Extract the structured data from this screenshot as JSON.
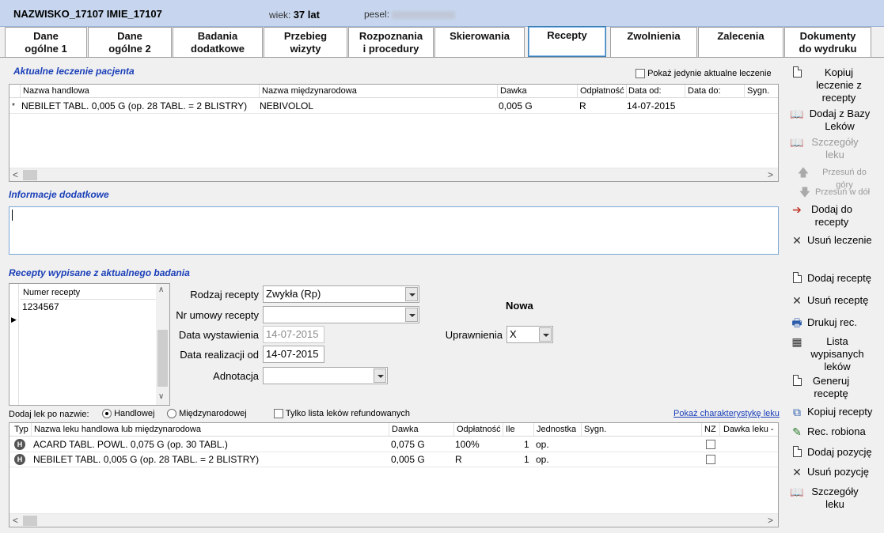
{
  "header": {
    "patient_name": "NAZWISKO_17107 IMIE_17107",
    "age_label": "wiek:",
    "age_value": "37 lat",
    "pesel_label": "pesel:"
  },
  "tabs": [
    {
      "line1": "Dane",
      "line2": "ogólne 1"
    },
    {
      "line1": "Dane",
      "line2": "ogólne 2"
    },
    {
      "line1": "Badania",
      "line2": "dodatkowe"
    },
    {
      "line1": "Przebieg",
      "line2": "wizyty"
    },
    {
      "line1": "Rozpoznania",
      "line2": "i procedury"
    },
    {
      "line1": "Skierowania",
      "line2": ""
    },
    {
      "line1": "Recepty",
      "line2": ""
    },
    {
      "line1": "Zwolnienia",
      "line2": ""
    },
    {
      "line1": "Zalecenia",
      "line2": ""
    },
    {
      "line1": "Dokumenty",
      "line2": "do wydruku"
    }
  ],
  "current_treatment": {
    "title": "Aktualne leczenie pacjenta",
    "only_current_label": "Pokaż jedynie aktualne leczenie",
    "columns": [
      "Nazwa handlowa",
      "Nazwa międzynarodowa",
      "Dawka",
      "Odpłatność",
      "Data od:",
      "Data do:",
      "Sygn."
    ],
    "rows": [
      {
        "marker": "*",
        "trade": "NEBILET TABL. 0,005 G (op. 28 TABL. = 2 BLISTRY)",
        "intl": "NEBIVOLOL",
        "dose": "0,005 G",
        "pay": "R",
        "from": "14-07-2015",
        "to": "",
        "sig": ""
      }
    ]
  },
  "additional_info": {
    "title": "Informacje dodatkowe",
    "value": ""
  },
  "prescriptions": {
    "title": "Recepty wypisane z aktualnego badania",
    "list_header": "Numer recepty",
    "numbers": [
      "1234567"
    ],
    "type_label": "Rodzaj recepty",
    "type_value": "Zwykła (Rp)",
    "contract_label": "Nr umowy recepty",
    "contract_value": "",
    "issue_date_label": "Data wystawienia",
    "issue_date_value": "14-07-2015",
    "realization_label": "Data realizacji od",
    "realization_value": "14-07-2015",
    "annotation_label": "Adnotacja",
    "annotation_value": "",
    "status": "Nowa",
    "entitlement_label": "Uprawnienia",
    "entitlement_value": "X"
  },
  "filter_bar": {
    "add_by_label": "Dodaj lek po nazwie:",
    "trade_option": "Handlowej",
    "intl_option": "Międzynarodowej",
    "refund_only_label": "Tylko lista leków refundowanych",
    "show_char_link": "Pokaż charakterystykę leku"
  },
  "drugs": {
    "columns": [
      "Typ",
      "Nazwa leku handlowa lub międzynarodowa",
      "Dawka",
      "Odpłatność",
      "Ile",
      "Jednostka",
      "Sygn.",
      "NZ",
      "Dawka leku -"
    ],
    "rows": [
      {
        "type": "H",
        "name": "ACARD TABL. POWL. 0,075 G (op. 30 TABL.)",
        "dose": "0,075 G",
        "pay": "100%",
        "qty": "1",
        "unit": "op.",
        "sig": ""
      },
      {
        "type": "H",
        "name": "NEBILET TABL. 0,005 G (op. 28 TABL. = 2 BLISTRY)",
        "dose": "0,005 G",
        "pay": "R",
        "qty": "1",
        "unit": "op.",
        "sig": ""
      }
    ]
  },
  "side_top": {
    "copy_treatment": "Kopiuj leczenie z recepty",
    "add_from_db": "Dodaj z Bazy Leków",
    "drug_details": "Szczegóły leku",
    "move_up": "Przesuń do góry",
    "move_down": "Przesuń w dół",
    "add_to_rx": "Dodaj do recepty",
    "delete_treatment": "Usuń leczenie"
  },
  "side_bottom": {
    "add_rx": "Dodaj receptę",
    "delete_rx": "Usuń receptę",
    "print_rx": "Drukuj rec.",
    "rx_list": "Lista wypisanych leków",
    "generate_rx": "Generuj receptę",
    "copy_rx": "Kopiuj recepty",
    "rx_done": "Rec. robiona",
    "add_item": "Dodaj pozycję",
    "delete_item": "Usuń pozycję",
    "drug_details2": "Szczegóły leku"
  }
}
